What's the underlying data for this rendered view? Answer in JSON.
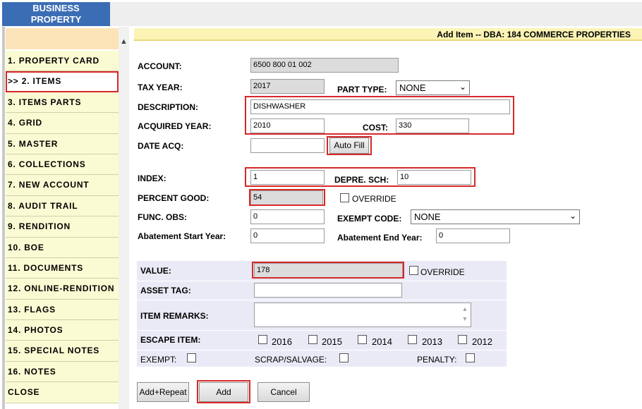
{
  "top_tab": {
    "line1": "BUSINESS",
    "line2": "PROPERTY"
  },
  "sidebar": {
    "items": [
      {
        "label": "1. PROPERTY CARD"
      },
      {
        "label": ">> 2. ITEMS"
      },
      {
        "label": "3. ITEMS PARTS"
      },
      {
        "label": "4. GRID"
      },
      {
        "label": "5. MASTER"
      },
      {
        "label": "6. COLLECTIONS"
      },
      {
        "label": "7. NEW ACCOUNT"
      },
      {
        "label": "8. AUDIT TRAIL"
      },
      {
        "label": "9. RENDITION"
      },
      {
        "label": "10. BOE"
      },
      {
        "label": "11. DOCUMENTS"
      },
      {
        "label": "12. ONLINE-RENDITION"
      },
      {
        "label": "13. FLAGS"
      },
      {
        "label": "14. PHOTOS"
      },
      {
        "label": "15. SPECIAL NOTES"
      },
      {
        "label": "16. NOTES"
      },
      {
        "label": "CLOSE"
      }
    ]
  },
  "header": {
    "title": "Add Item --  DBA:  184 COMMERCE PROPERTIES"
  },
  "form": {
    "account": {
      "label": "ACCOUNT:",
      "value": "6500 800 01 002"
    },
    "tax_year": {
      "label": "TAX YEAR:",
      "value": "2017"
    },
    "part_type": {
      "label": "PART TYPE:",
      "value": "NONE"
    },
    "description": {
      "label": "DESCRIPTION:",
      "value": "DISHWASHER"
    },
    "acquired_year": {
      "label": "ACQUIRED YEAR:",
      "value": "2010"
    },
    "cost": {
      "label": "COST:",
      "value": "330"
    },
    "date_acq": {
      "label": "DATE ACQ:",
      "value": ""
    },
    "auto_fill": "Auto Fill",
    "index": {
      "label": "INDEX:",
      "value": "1"
    },
    "depre_sch": {
      "label": "DEPRE. SCH:",
      "value": "10"
    },
    "percent_good": {
      "label": "PERCENT GOOD:",
      "value": "54"
    },
    "override": "OVERRIDE",
    "func_obs": {
      "label": "FUNC. OBS:",
      "value": "0"
    },
    "exempt_code": {
      "label": "EXEMPT CODE:",
      "value": "NONE"
    },
    "abatement_start": {
      "label": "Abatement Start Year:",
      "value": "0"
    },
    "abatement_end": {
      "label": "Abatement End Year:",
      "value": "0"
    }
  },
  "panel": {
    "value": {
      "label": "VALUE:",
      "value": "178"
    },
    "override": "OVERRIDE",
    "asset_tag": {
      "label": "ASSET TAG:",
      "value": ""
    },
    "item_remarks": {
      "label": "ITEM REMARKS:",
      "value": ""
    },
    "escape_item": {
      "label": "ESCAPE ITEM:",
      "years": [
        "2016",
        "2015",
        "2014",
        "2013",
        "2012"
      ]
    },
    "exempt": "EXEMPT:",
    "scrap_salvage": "SCRAP/SALVAGE:",
    "penalty": "PENALTY:"
  },
  "buttons": {
    "add_repeat": "Add+Repeat",
    "add": "Add",
    "cancel": "Cancel"
  },
  "colors": {
    "accent_red": "#d62828",
    "tab_blue": "#3b6db4",
    "sidebar_yellow": "#fbfbd3",
    "panel_lavender": "#eaeaf7"
  }
}
